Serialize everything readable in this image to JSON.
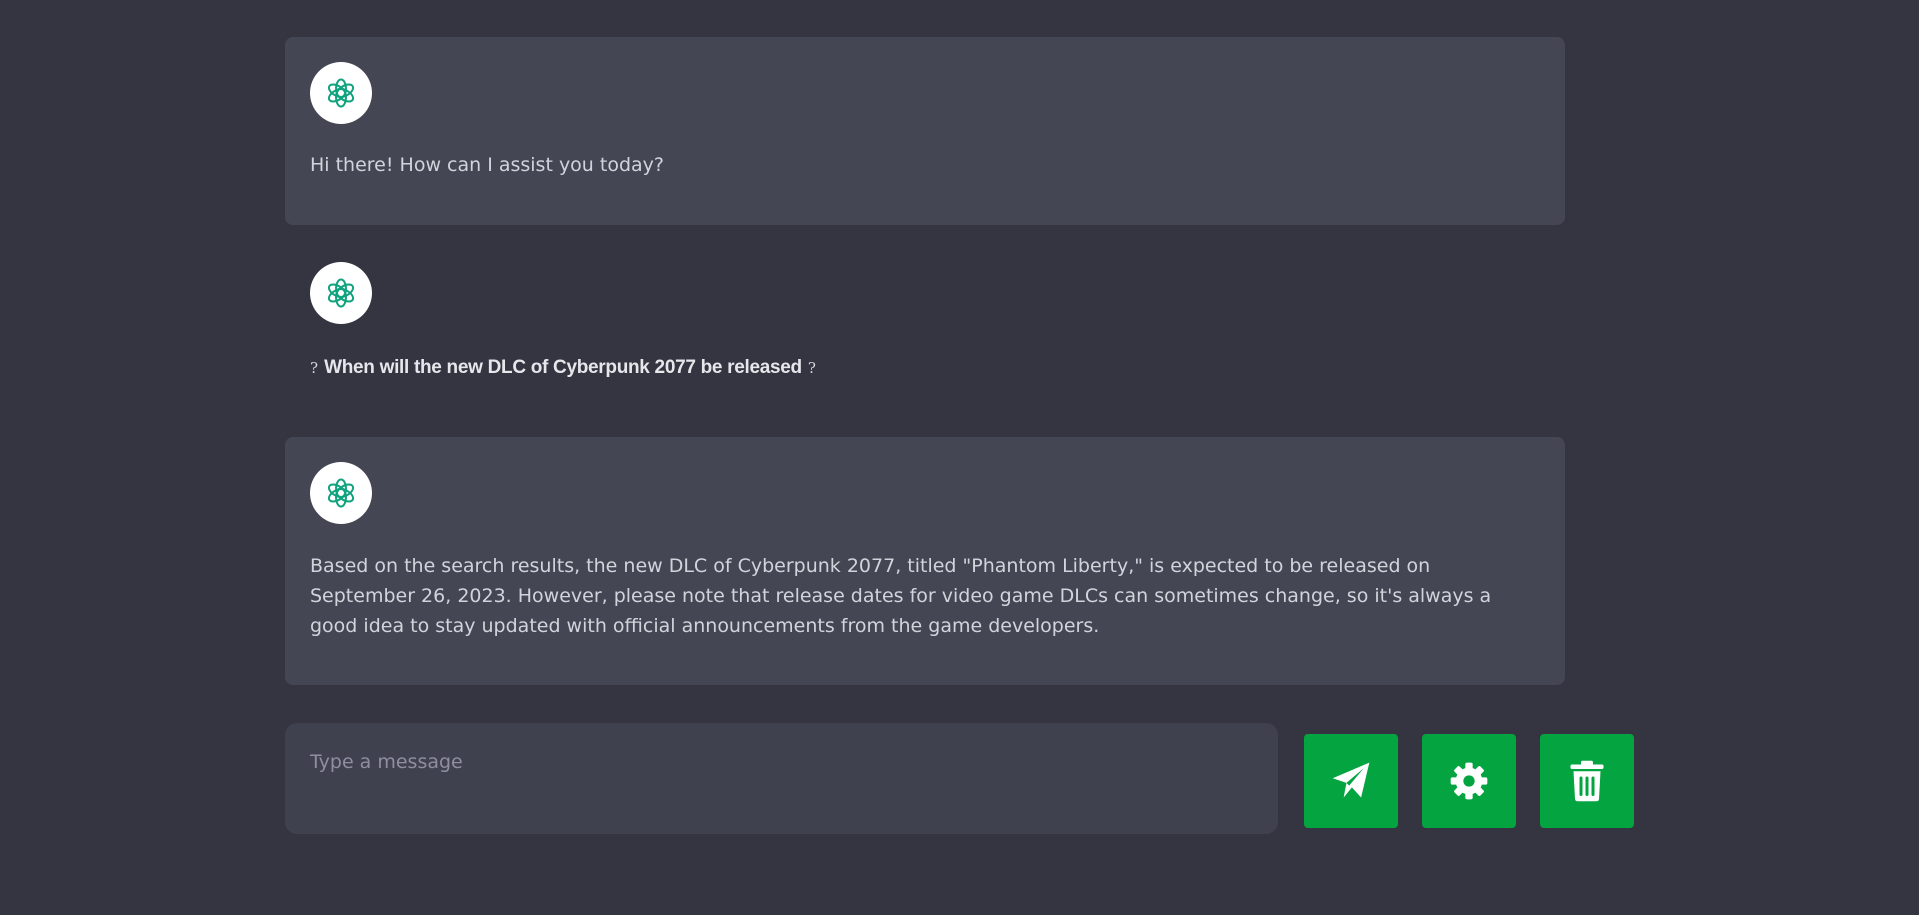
{
  "colors": {
    "background": "#343541",
    "bot_message_bg": "#444654",
    "input_bg": "#40414f",
    "accent_green": "#04a440",
    "logo_green": "#10a37f"
  },
  "messages": [
    {
      "role": "assistant",
      "avatar_icon": "openai-logo-icon",
      "text": "Hi there! How can I assist you today?"
    },
    {
      "role": "user",
      "avatar_icon": "openai-logo-icon",
      "prefix": "?",
      "text": "When will the new DLC of Cyberpunk 2077 be released",
      "suffix": "?"
    },
    {
      "role": "assistant",
      "avatar_icon": "openai-logo-icon",
      "text": "Based on the search results, the new DLC of Cyberpunk 2077, titled \"Phantom Liberty,\" is expected to be released on September 26, 2023. However, please note that release dates for video game DLCs can sometimes change, so it's always a good idea to stay updated with official announcements from the game developers."
    }
  ],
  "composer": {
    "value": "",
    "placeholder": "Type a message"
  },
  "actions": {
    "send_icon": "paper-plane-icon",
    "settings_icon": "gear-icon",
    "delete_icon": "trash-icon"
  }
}
